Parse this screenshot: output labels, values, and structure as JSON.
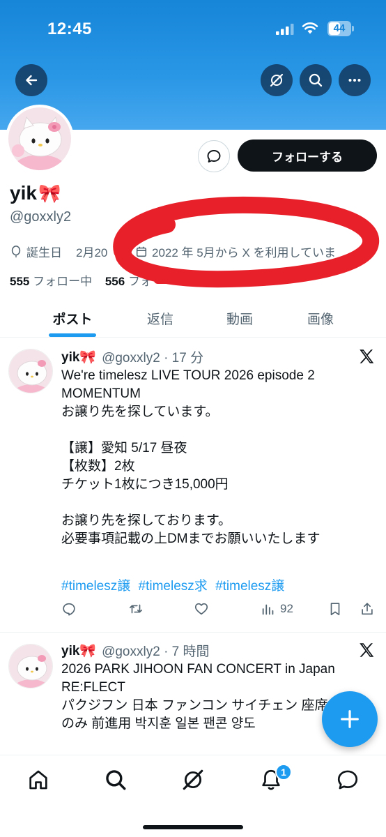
{
  "status_bar": {
    "time": "12:45",
    "battery": "44"
  },
  "profile": {
    "display_name": "yik",
    "name_emoji": "🎀",
    "handle": "@goxxly2",
    "follow_button": "フォローする",
    "birthday_label": "誕生日",
    "birthday_value": "2月20",
    "joined": "2022 年 5月から X を利用していま",
    "following_count": "555",
    "following_label": "フォロー中",
    "followers_count": "556",
    "followers_label": "フォ"
  },
  "tabs": [
    "ポスト",
    "返信",
    "動画",
    "画像"
  ],
  "tweets": [
    {
      "name": "yik🎀",
      "handle_time": "@goxxly2 · 17 分",
      "body": "We're timelesz LIVE TOUR 2026 episode 2\nMOMENTUM\nお譲り先を探しています。\n\n【譲】愛知 5/17 昼夜\n【枚数】2枚\nチケット1枚につき15,000円\n\nお譲り先を探しております。\n必要事項記載の上DMまでお願いいたします",
      "hashtags": [
        "#timelesz譲",
        "#timelesz求",
        "#timelesz譲"
      ],
      "views": "92"
    },
    {
      "name": "yik🎀",
      "handle_time": "@goxxly2 · 7 時間",
      "body": "2026 PARK JIHOON FAN CONCERT in Japan\nRE:FLECT\nパクジフン 日本 ファンコン サイチェン 座席\nのみ 前進用 박지훈 일본 팬콘 양도"
    }
  ],
  "nav": {
    "notification_badge": "1"
  },
  "colors": {
    "accent": "#1d9bf0",
    "banner": "#1785d8",
    "annotation": "#e8202a"
  }
}
